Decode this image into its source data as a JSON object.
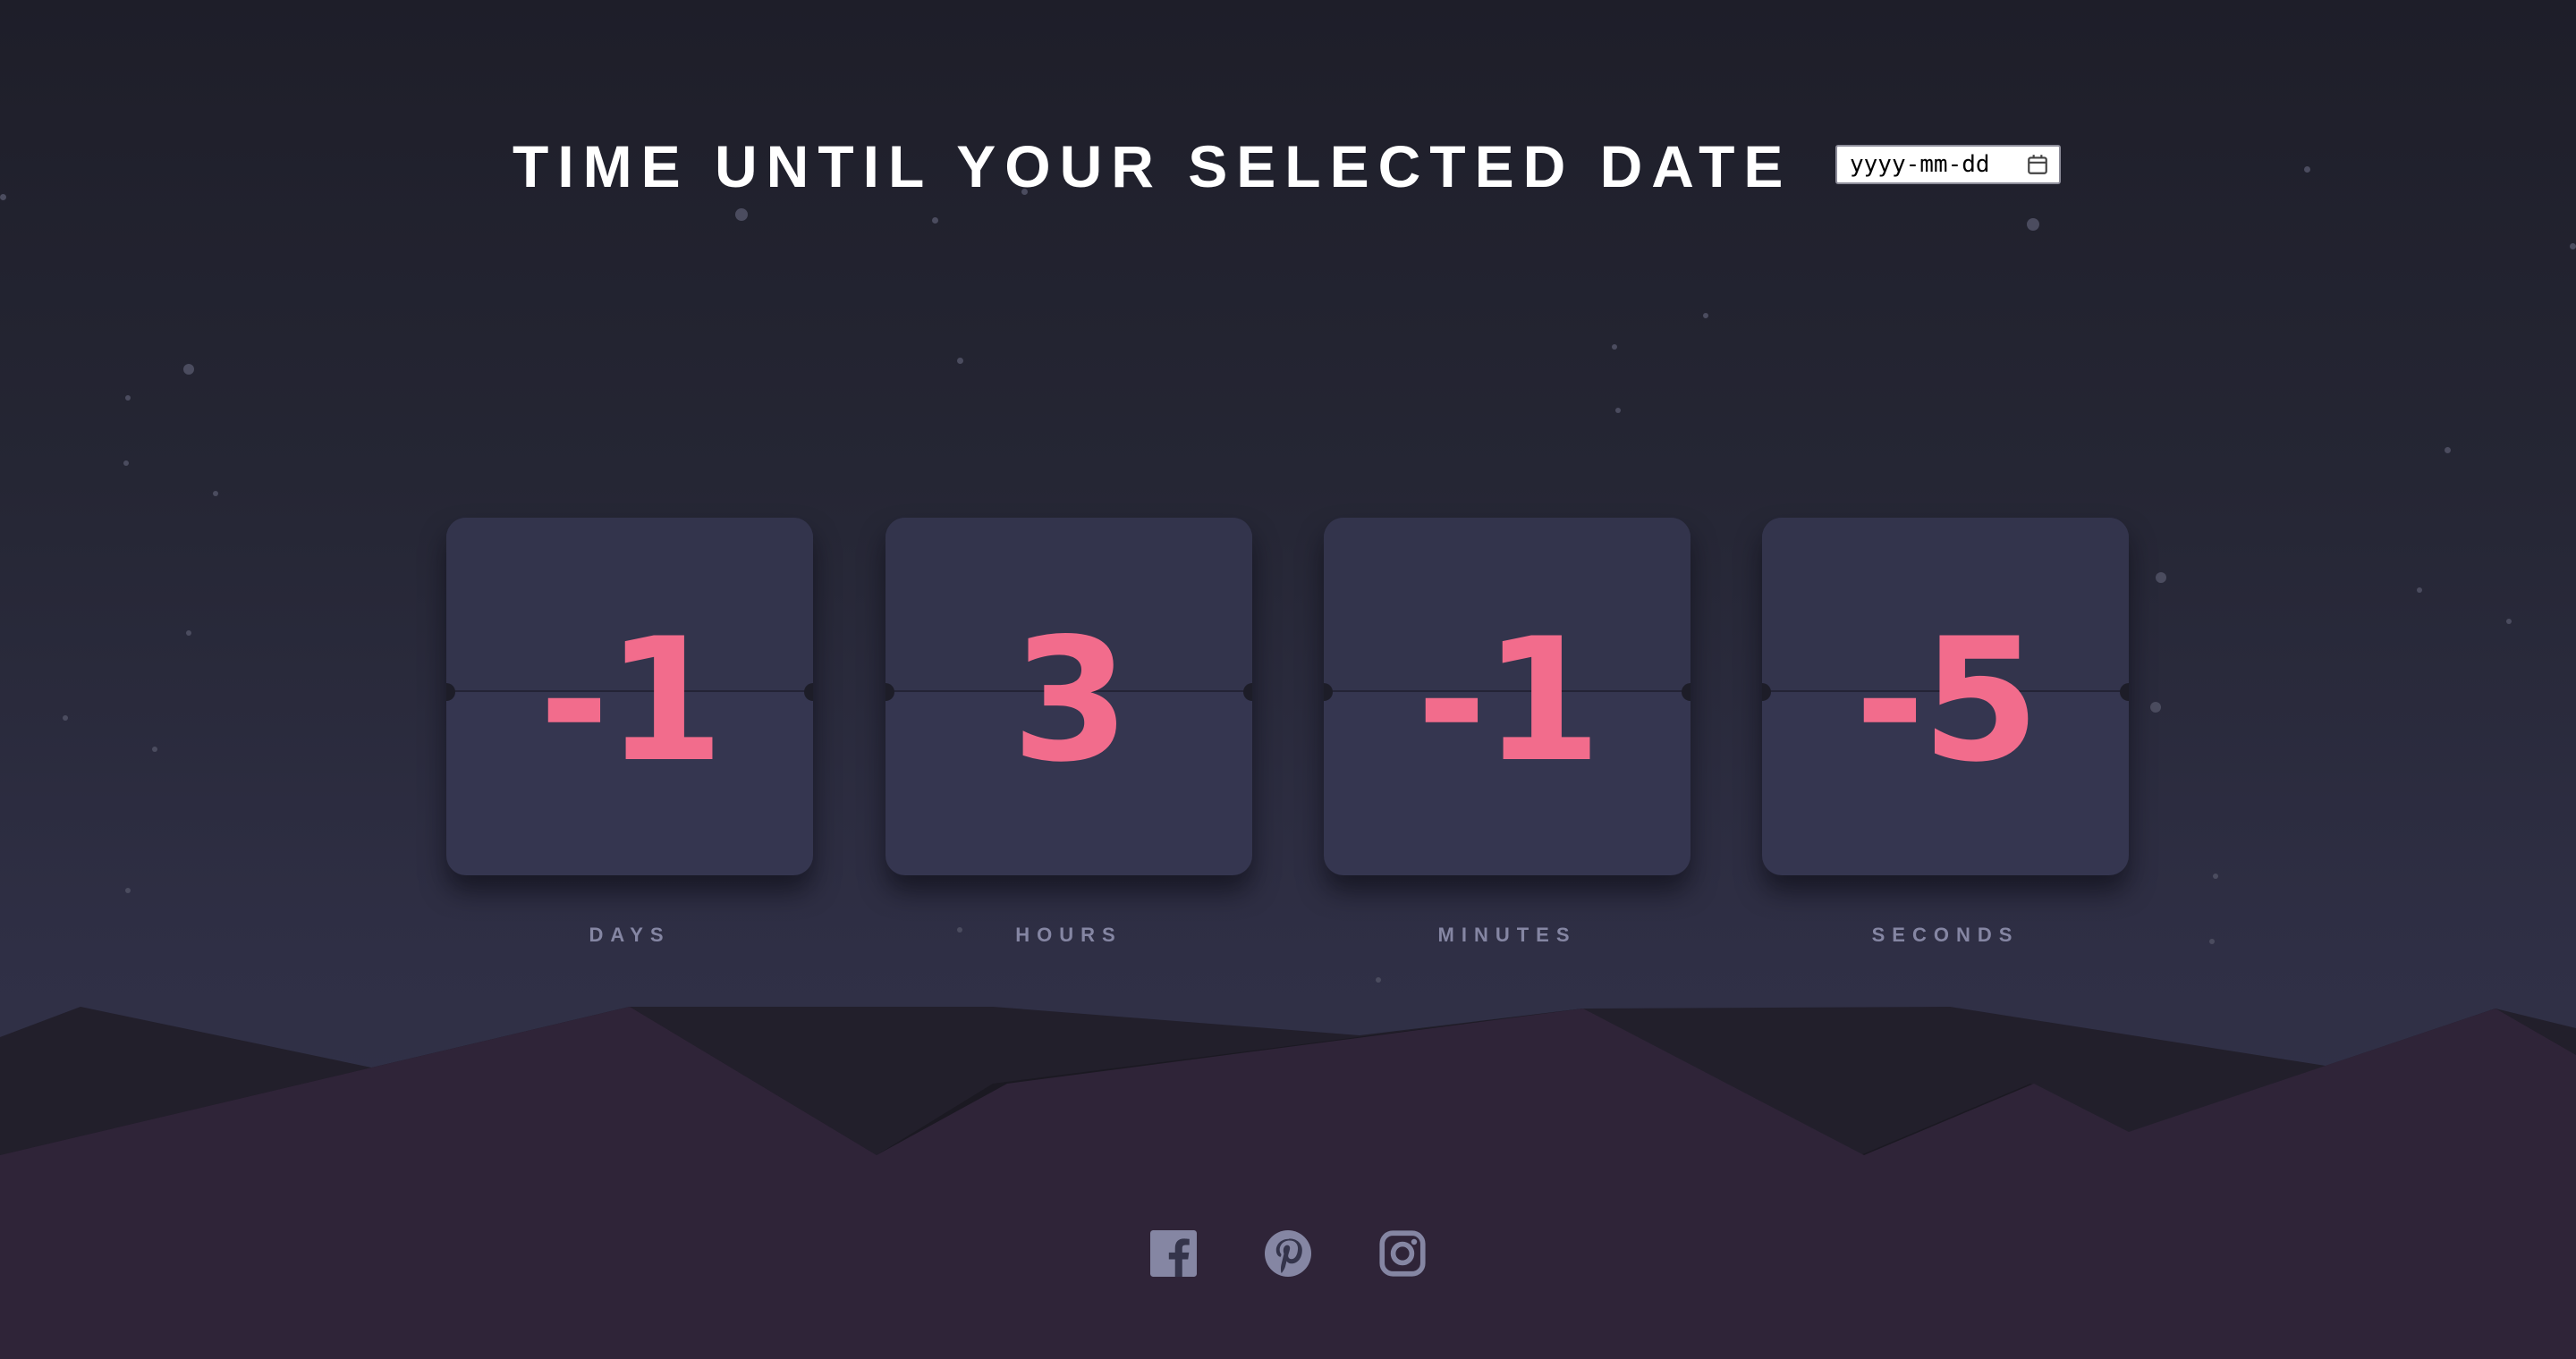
{
  "header": {
    "title": "TIME UNTIL YOUR SELECTED DATE",
    "date_input": {
      "placeholder": "yyyy-mm-dd",
      "value": ""
    }
  },
  "countdown": [
    {
      "value": "-1",
      "label": "DAYS"
    },
    {
      "value": "3",
      "label": "HOURS"
    },
    {
      "value": "-1",
      "label": "MINUTES"
    },
    {
      "value": "-5",
      "label": "SECONDS"
    }
  ],
  "social": [
    {
      "icon": "facebook-icon"
    },
    {
      "icon": "pinterest-icon"
    },
    {
      "icon": "instagram-icon"
    }
  ],
  "colors": {
    "background_top": "#1e1e29",
    "background_bottom": "#34344b",
    "card": "#34354f",
    "digit": "#f26c8c",
    "label": "#8586a3",
    "hills_front": "#2f2438",
    "hills_back": "#1c1a24",
    "social_icon": "#8586a3"
  }
}
